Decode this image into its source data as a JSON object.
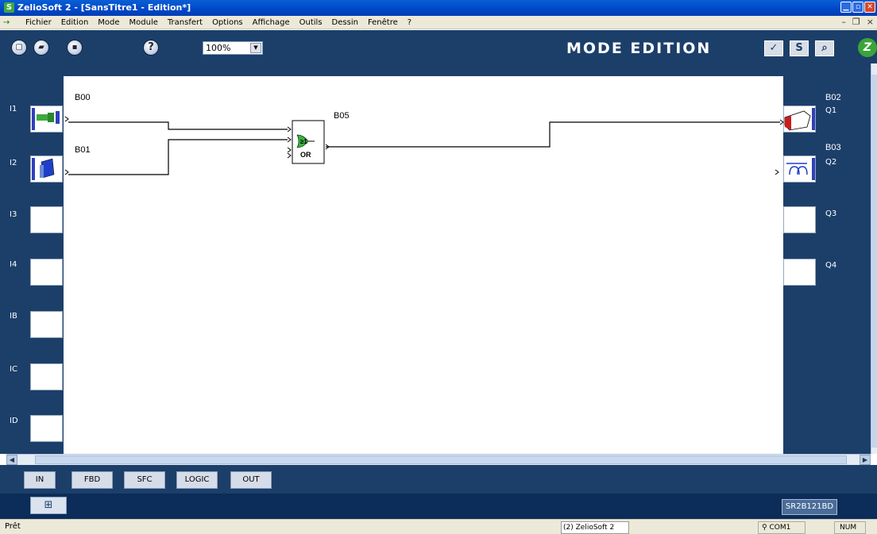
{
  "window": {
    "title": "ZelioSoft 2 - [SansTitre1 - Edition*]",
    "controls": {
      "minimize": "minimize-icon",
      "maximize": "maximize-icon",
      "close": "close-icon"
    }
  },
  "menubar": {
    "items": [
      "Fichier",
      "Edition",
      "Mode",
      "Module",
      "Transfert",
      "Options",
      "Affichage",
      "Outils",
      "Dessin",
      "Fenêtre",
      "?"
    ]
  },
  "toolbar": {
    "new": "new-file-icon",
    "open": "open-folder-icon",
    "save": "save-icon",
    "help_glyph": "?",
    "zoom_value": "100%",
    "mode_label": "MODE EDITION",
    "s_label": "S"
  },
  "inputs": [
    {
      "label": "I1",
      "block": "B00"
    },
    {
      "label": "I2",
      "block": "B01"
    },
    {
      "label": "I3"
    },
    {
      "label": "I4"
    },
    {
      "label": "IB"
    },
    {
      "label": "IC"
    },
    {
      "label": "ID"
    }
  ],
  "outputs": [
    {
      "label": "Q1",
      "block": "B02"
    },
    {
      "label": "Q2",
      "block": "B03"
    },
    {
      "label": "Q3"
    },
    {
      "label": "Q4"
    }
  ],
  "function_block": {
    "name": "B05",
    "gate_symbol": "≥1",
    "gate_type": "OR"
  },
  "tabs": [
    "IN",
    "FBD",
    "SFC",
    "LOGIC",
    "OUT"
  ],
  "module": {
    "reference": "SR2B121BD"
  },
  "status": {
    "text": "Prêt",
    "taskbar_item": "(2) ZelioSoft 2",
    "com_port": "COM1",
    "num_lock": "NUM"
  }
}
